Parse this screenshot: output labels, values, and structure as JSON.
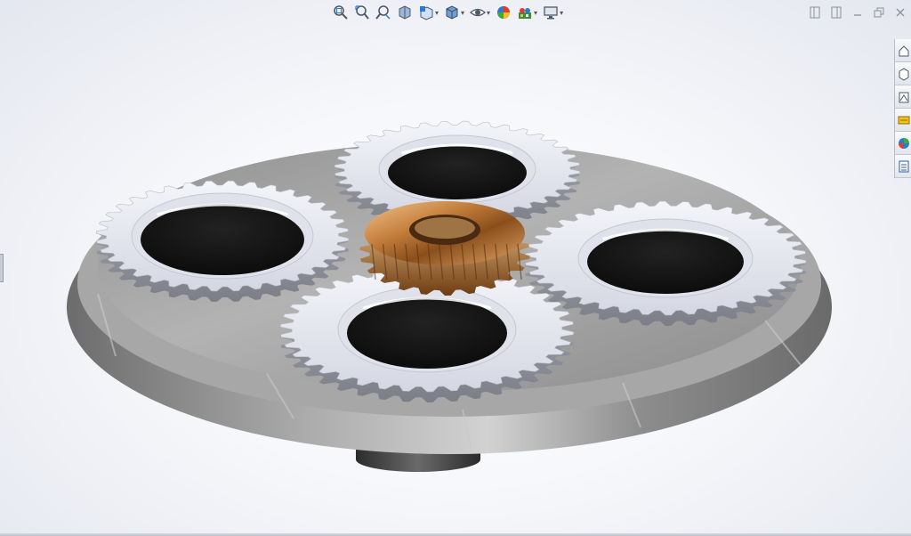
{
  "window": {
    "controls": [
      {
        "name": "tile-left",
        "icon": "tile-left-icon"
      },
      {
        "name": "tile-right",
        "icon": "tile-right-icon"
      },
      {
        "name": "minimize",
        "icon": "minimize-icon"
      },
      {
        "name": "restore",
        "icon": "restore-icon"
      },
      {
        "name": "close",
        "icon": "close-icon"
      }
    ]
  },
  "heads_up_toolbar": [
    {
      "name": "zoom-to-fit",
      "icon": "zoom-to-fit-icon",
      "dropdown": false
    },
    {
      "name": "zoom-to-area",
      "icon": "zoom-to-area-icon",
      "dropdown": false
    },
    {
      "name": "previous-view",
      "icon": "previous-view-icon",
      "dropdown": false
    },
    {
      "name": "section-view",
      "icon": "section-view-icon",
      "dropdown": false
    },
    {
      "name": "view-orientation",
      "icon": "view-orientation-icon",
      "dropdown": true
    },
    {
      "name": "display-style",
      "icon": "display-style-icon",
      "dropdown": true
    },
    {
      "name": "hide-show-items",
      "icon": "eye-icon",
      "dropdown": true
    },
    {
      "name": "edit-appearance",
      "icon": "appearance-sphere-icon",
      "dropdown": false
    },
    {
      "name": "apply-scene",
      "icon": "scene-icon",
      "dropdown": true
    },
    {
      "name": "view-settings",
      "icon": "monitor-icon",
      "dropdown": true
    }
  ],
  "task_pane": [
    {
      "name": "solidworks-resources",
      "icon": "home-icon"
    },
    {
      "name": "design-library",
      "icon": "design-library-icon"
    },
    {
      "name": "file-explorer",
      "icon": "file-explorer-icon"
    },
    {
      "name": "view-palette",
      "icon": "view-palette-icon"
    },
    {
      "name": "appearances-scenes-decals",
      "icon": "appearances-icon"
    },
    {
      "name": "custom-properties",
      "icon": "custom-properties-icon"
    }
  ],
  "model": {
    "description_colors": {
      "base_plate": "#9b9b9b",
      "spur_gear": "#e7e9f2",
      "sun_gear": "#c98a4b",
      "gear_bore": "#141414"
    },
    "planet_gear_count": 4,
    "sun_gear_count": 1
  },
  "colors": {
    "accent_blue": "#2a7bd4",
    "toolbar_icon": "#4d5a6b"
  }
}
